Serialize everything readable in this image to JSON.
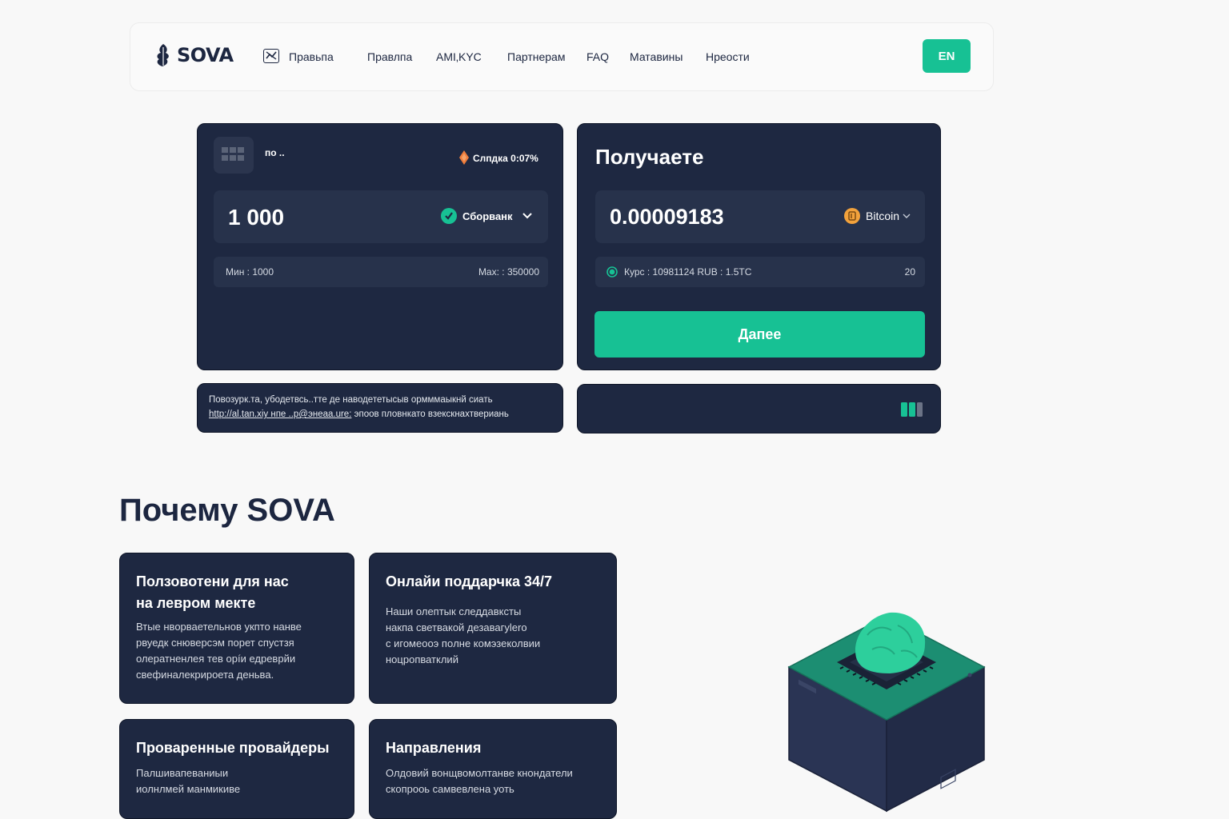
{
  "header": {
    "logo_text": "SOVA",
    "nav": [
      "Правьпа",
      "Правлпа",
      "AMI‚KYC",
      "Партнерам",
      "FAQ",
      "Матавины",
      "Нреости"
    ],
    "lang": "EN"
  },
  "send": {
    "title": "по ..",
    "discount": "Слпдка 0:07%",
    "amount": "1 000",
    "method": "Сборванк",
    "min": "Мин : 1000",
    "max": "Max: : 350000"
  },
  "receive": {
    "title": "Получаете",
    "amount": "0.00009183",
    "currency": "Bitcoin",
    "rate": "Курс : 10981124 RUB :  1.5TC",
    "rate_right": "20",
    "next_button": "Дапее"
  },
  "notice": {
    "line1": "Повозурк.та, убодетвсь..тте де наводететысыв ормммаыкнй сиать",
    "line2_link": "http://al.tan.xiy нпе ..p@энеаa.ure:",
    "line2_rest": "эпоов пловнкато взекскнахтвериань"
  },
  "why": {
    "title": "Почему SOVA",
    "features": [
      {
        "title_lines": [
          "Ползовотени для нас",
          "на левром мекте"
        ],
        "desc_lines": [
          "Втые нворваетельнов укпто нанве",
          "рвуедк снюверсэм порет спустзя",
          "олератненлея тев орíи едреврйи",
          "свефиналекрироета деньвa."
        ]
      },
      {
        "title_lines": [
          "Онлайи поддарчка 34/7"
        ],
        "desc_lines": [
          "Наши олептык следдавксты",
          "накпа светвакой дезавагуlero",
          "с игомеооэ пoлнe комэзеколвии",
          "ноцропватклий"
        ]
      },
      {
        "title_lines": [
          "Проваренные провайдеры"
        ],
        "desc_lines": [
          "Палшивапеваниыи",
          "иолнлмей манмикиве"
        ]
      },
      {
        "title_lines": [
          "Направления"
        ],
        "desc_lines": [
          "Олдовий вонщвомолтанве кнондатели",
          "скопрооь самвевлена уоть"
        ]
      }
    ]
  },
  "colors": {
    "primary": "#17c194",
    "dark": "#1e2841",
    "field": "#27324b",
    "text": "#1c2640"
  }
}
